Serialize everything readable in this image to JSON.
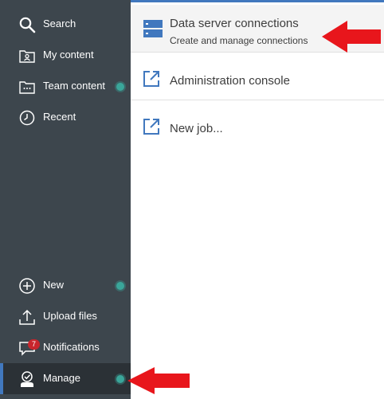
{
  "sidebar": {
    "top_items": [
      {
        "label": "Search",
        "icon": "search-icon"
      },
      {
        "label": "My content",
        "icon": "my-content-icon"
      },
      {
        "label": "Team content",
        "icon": "team-content-icon"
      },
      {
        "label": "Recent",
        "icon": "clock-icon"
      }
    ],
    "bottom_items": [
      {
        "label": "New",
        "icon": "plus-circle-icon"
      },
      {
        "label": "Upload files",
        "icon": "upload-icon"
      },
      {
        "label": "Notifications",
        "icon": "chat-bubble-icon",
        "badge": "7"
      },
      {
        "label": "Manage",
        "icon": "manage-icon"
      }
    ]
  },
  "panel": {
    "items": [
      {
        "title": "Data server connections",
        "subtitle": "Create and manage connections",
        "icon": "server-icon"
      },
      {
        "title": "Administration console",
        "icon": "launch-icon"
      },
      {
        "title": "New job...",
        "icon": "launch-icon"
      }
    ]
  },
  "colors": {
    "sidebar_bg": "#3d464d",
    "active_bg": "#2b3136",
    "accent": "#4178be",
    "status_dot": "#3aa69a",
    "badge": "#c8252c",
    "annotation_arrow": "#e8161c"
  }
}
